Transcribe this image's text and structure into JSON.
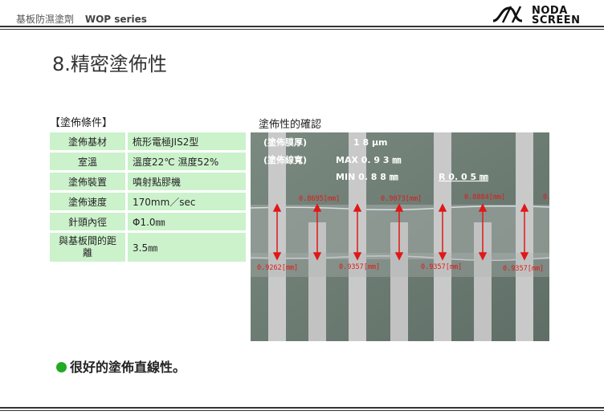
{
  "header": {
    "doc_name": "基板防濕塗劑",
    "series": "WOP series",
    "logo_line1": "NODA",
    "logo_line2": "SCREEN"
  },
  "title": "8.精密塗佈性",
  "conditions": {
    "label": "【塗佈條件】",
    "rows": [
      {
        "key": "塗佈基材",
        "value": "梳形電極JIS2型"
      },
      {
        "key": "室溫",
        "value": "溫度22℃ 濕度52%"
      },
      {
        "key": "塗佈裝置",
        "value": "噴射點膠機"
      },
      {
        "key": "塗佈速度",
        "value": "170mm／sec"
      },
      {
        "key": "針頭內徑",
        "value": "Φ1.0㎜"
      },
      {
        "key": "與基板間的距離",
        "value": "3.5㎜"
      }
    ]
  },
  "photo": {
    "label": "塗佈性的確認",
    "thickness_label": "(塗佈膜厚)",
    "thickness_value": "1 8 μm",
    "width_label": "(塗佈線寬)",
    "max_text": "MAX  0. 9 3 ㎜",
    "min_text": "MIN   0. 8 8 ㎜",
    "r_text": "R   0. 0 5 ㎜",
    "top_measures": [
      "0.8695[mm]",
      "0.9073[mm]",
      "0.8884[mm]"
    ],
    "bottom_measures": [
      "0.9262[mm]",
      "0.9357[mm]",
      "0.9357[mm]",
      "0.9357[mm]"
    ],
    "edge_measure": "0."
  },
  "bullet": "很好的塗佈直線性。",
  "colors": {
    "table_fill": "#ccf2cc",
    "bullet_dot": "#22aa22",
    "measure_red": "#e01818"
  }
}
